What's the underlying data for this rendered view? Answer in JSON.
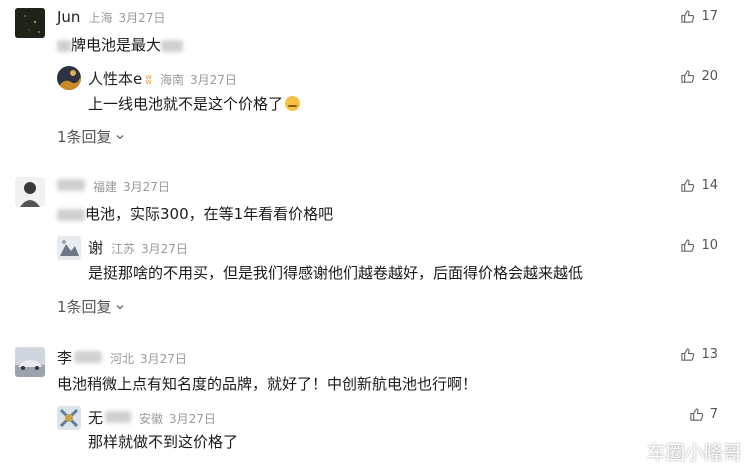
{
  "comments": [
    {
      "user": "Jun",
      "region": "上海",
      "date": "3月27日",
      "text_a": "",
      "text_b": "牌电池是最大",
      "likes": "17",
      "reply": {
        "user": "人性本e",
        "region": "海南",
        "date": "3月27日",
        "text": "上一线电池就不是这个价格了",
        "likes": "20"
      },
      "replies_link": "1条回复"
    },
    {
      "user": "",
      "region": "福建",
      "date": "3月27日",
      "text": "电池，实际300，在等1年看看价格吧",
      "likes": "14",
      "reply": {
        "user": "谢",
        "region": "江苏",
        "date": "3月27日",
        "text": "是挺那啥的不用买，但是我们得感谢他们越卷越好，后面得价格会越来越低",
        "likes": "10"
      },
      "replies_link": "1条回复"
    },
    {
      "user": "李",
      "region": "河北",
      "date": "3月27日",
      "text": "电池稍微上点有知名度的品牌，就好了！中创新航电池也行啊！",
      "likes": "13",
      "reply": {
        "user": "无",
        "region": "安徽",
        "date": "3月27日",
        "text": "那样就做不到这价格了",
        "likes": "7"
      }
    }
  ],
  "watermark": "车圈小隆哥",
  "icons": {
    "like": "thumbs-up-icon",
    "chevron": "chevron-down-icon",
    "weibo": "weibo-logo-icon"
  }
}
